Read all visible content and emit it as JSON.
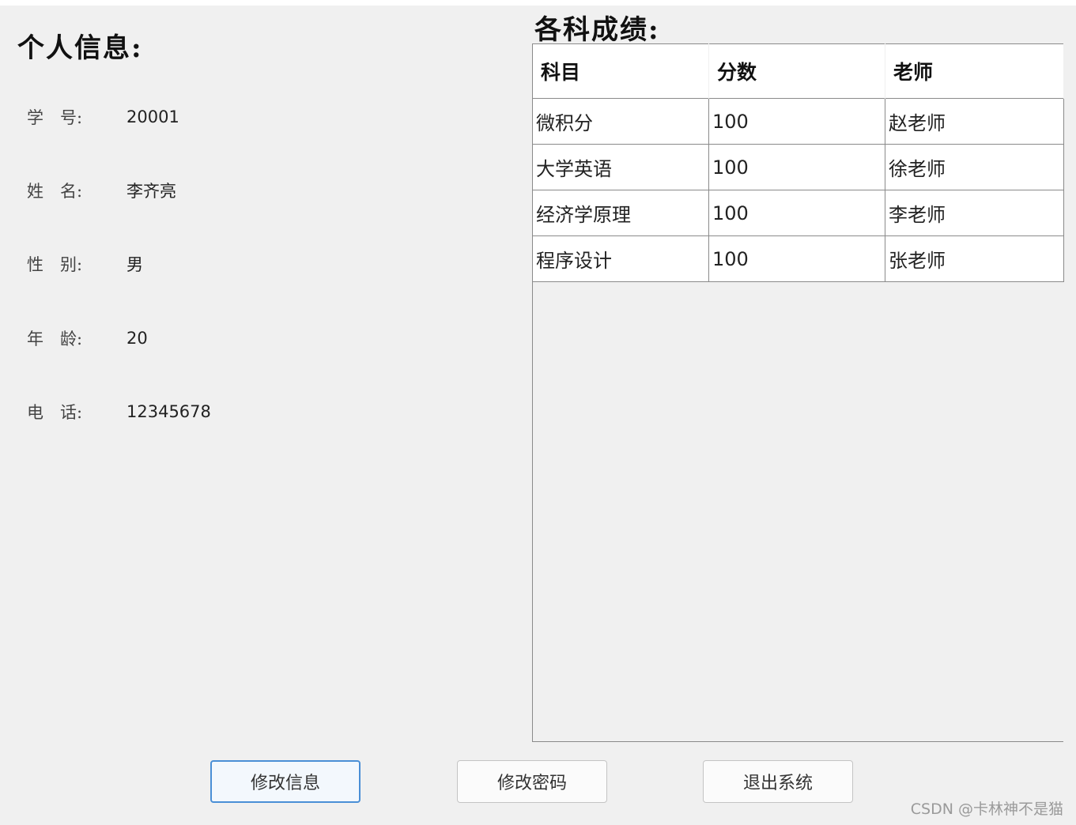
{
  "personal_info": {
    "title": "个人信息:",
    "fields": [
      {
        "label": "学　号:",
        "value": "20001"
      },
      {
        "label": "姓　名:",
        "value": "李齐亮"
      },
      {
        "label": "性　别:",
        "value": "男"
      },
      {
        "label": "年　龄:",
        "value": "20"
      },
      {
        "label": "电　话:",
        "value": "12345678"
      }
    ]
  },
  "grades": {
    "title": "各科成绩:",
    "columns": [
      "科目",
      "分数",
      "老师"
    ],
    "rows": [
      [
        "微积分",
        "100",
        "赵老师"
      ],
      [
        "大学英语",
        "100",
        "徐老师"
      ],
      [
        "经济学原理",
        "100",
        "李老师"
      ],
      [
        "程序设计",
        "100",
        "张老师"
      ]
    ]
  },
  "buttons": {
    "edit_info": "修改信息",
    "change_password": "修改密码",
    "exit": "退出系统"
  },
  "watermark": "CSDN @卡林神不是猫",
  "colors": {
    "window_bg": "#f0f0f0",
    "primary_button_border": "#4a8fd6",
    "table_border": "#8a8a8a"
  }
}
